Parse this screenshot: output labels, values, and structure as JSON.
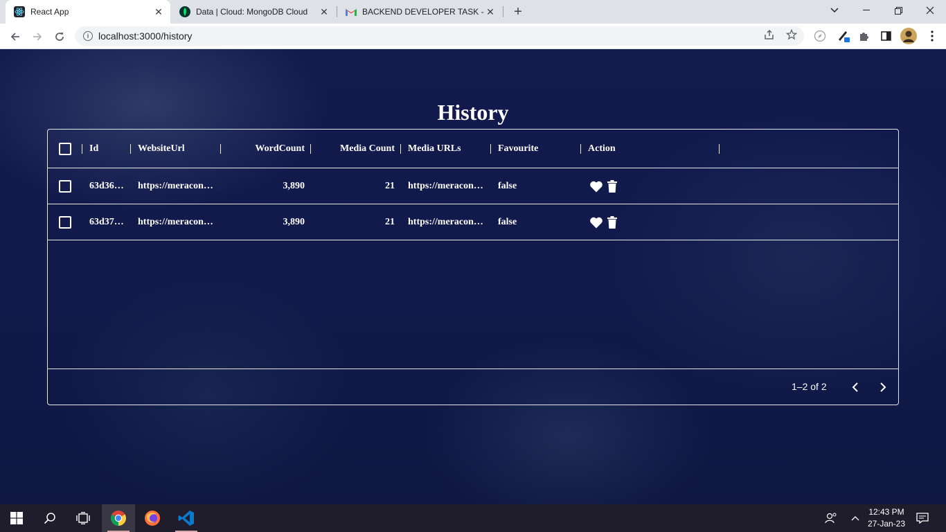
{
  "browser": {
    "tabs": [
      {
        "title": "React App",
        "icon": "react-icon",
        "active": true
      },
      {
        "title": "Data | Cloud: MongoDB Cloud",
        "icon": "mongodb-leaf-icon",
        "active": false
      },
      {
        "title": "BACKEND DEVELOPER TASK - faz",
        "icon": "gmail-icon",
        "active": false
      }
    ],
    "url": "localhost:3000/history"
  },
  "page": {
    "title": "History"
  },
  "grid": {
    "columns": [
      "Id",
      "WebsiteUrl",
      "WordCount",
      "Media Count",
      "Media URLs",
      "Favourite",
      "Action"
    ],
    "rows": [
      {
        "id": "63d36…",
        "website_url": "https://meracon…",
        "word_count": "3,890",
        "media_count": "21",
        "media_urls": "https://meracon…",
        "favourite": "false"
      },
      {
        "id": "63d37…",
        "website_url": "https://meracon…",
        "word_count": "3,890",
        "media_count": "21",
        "media_urls": "https://meracon…",
        "favourite": "false"
      }
    ],
    "pagination": "1–2 of 2"
  },
  "taskbar": {
    "time": "12:43 PM",
    "date": "27-Jan-23"
  },
  "colors": {
    "page_bg": "#111a4a",
    "text": "#ffffff",
    "tab_strip": "#dee1e6",
    "taskbar": "#1f1c2c",
    "vscode_blue": "#0a7acc",
    "firefox_orange": "#ff7139"
  }
}
